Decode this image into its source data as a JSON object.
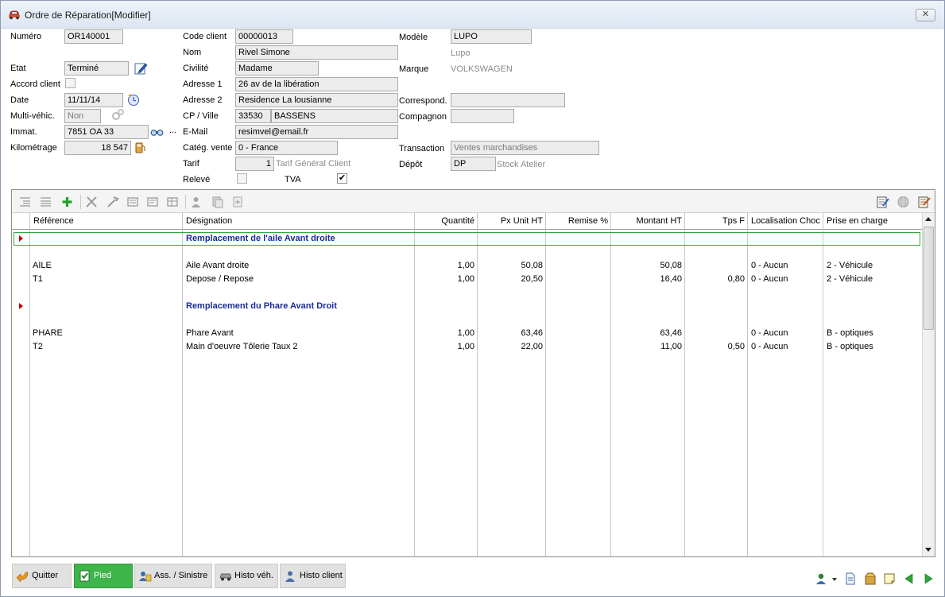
{
  "window": {
    "title": "Ordre de Réparation[Modifier]",
    "close_label": "✕"
  },
  "form": {
    "numero": {
      "label": "Numéro",
      "value": "OR140001"
    },
    "etat": {
      "label": "Etat",
      "value": "Terminé"
    },
    "accord": {
      "label": "Accord client"
    },
    "date": {
      "label": "Date",
      "value": "11/11/14"
    },
    "multi": {
      "label": "Multi-véhic.",
      "value": "Non"
    },
    "immat": {
      "label": "Immat.",
      "value": "7851 OA 33",
      "more": "..."
    },
    "km": {
      "label": "Kilométrage",
      "value": "18 547"
    },
    "code_client": {
      "label": "Code client",
      "value": "00000013"
    },
    "nom": {
      "label": "Nom",
      "value": "Rivel Simone"
    },
    "civilite": {
      "label": "Civilité",
      "value": "Madame"
    },
    "adresse1": {
      "label": "Adresse 1",
      "value": "26 av de la libération"
    },
    "adresse2": {
      "label": "Adresse 2",
      "value": "Residence La lousianne"
    },
    "cp_ville": {
      "label": "CP / Ville",
      "cp": "33530",
      "ville": "BASSENS"
    },
    "email": {
      "label": "E-Mail",
      "value": "resimvel@email.fr"
    },
    "categ": {
      "label": "Catég. vente",
      "value": "0 - France"
    },
    "tarif": {
      "label": "Tarif",
      "value": "1",
      "desc": "Tarif Général Client"
    },
    "releve": {
      "label": "Relevé"
    },
    "tva": {
      "label": "TVA",
      "checked": "✔"
    },
    "modele": {
      "label": "Modèle",
      "value": "LUPO",
      "sub": "Lupo"
    },
    "marque": {
      "label": "Marque",
      "value": "VOLKSWAGEN"
    },
    "correspond": {
      "label": "Correspond.",
      "value": ""
    },
    "compagnon": {
      "label": "Compagnon",
      "value": ""
    },
    "transaction": {
      "label": "Transaction",
      "value": "Ventes marchandises"
    },
    "depot": {
      "label": "Dépôt",
      "value": "DP",
      "desc": "Stock Atelier"
    }
  },
  "grid": {
    "columns": [
      "Référence",
      "Désignation",
      "Quantité",
      "Px Unit HT",
      "Remise %",
      "Montant HT",
      "Tps F",
      "Localisation Choc",
      "Prise en charge"
    ],
    "sections": [
      {
        "title": "Remplacement de l'aile Avant droite",
        "rows": [
          {
            "ref": "AILE",
            "des": "Aile Avant droite",
            "qte": "1,00",
            "px": "50,08",
            "remise": "",
            "montant": "50,08",
            "tps": "",
            "loc": "0 - Aucun",
            "prise": "2 - Véhicule"
          },
          {
            "ref": "T1",
            "des": "Depose / Repose",
            "qte": "1,00",
            "px": "20,50",
            "remise": "",
            "montant": "16,40",
            "tps": "0,80",
            "loc": "0 - Aucun",
            "prise": "2 - Véhicule"
          }
        ]
      },
      {
        "title": "Remplacement du Phare Avant Droit",
        "rows": [
          {
            "ref": "PHARE",
            "des": "Phare Avant",
            "qte": "1,00",
            "px": "63,46",
            "remise": "",
            "montant": "63,46",
            "tps": "",
            "loc": "0 - Aucun",
            "prise": "B - optiques"
          },
          {
            "ref": "T2",
            "des": "Main d'oeuvre Tôlerie Taux 2",
            "qte": "1,00",
            "px": "22,00",
            "remise": "",
            "montant": "11,00",
            "tps": "0,50",
            "loc": "0 - Aucun",
            "prise": "B - optiques"
          }
        ]
      }
    ]
  },
  "footer": {
    "quitter": "Quitter",
    "pied": "Pied",
    "ass": "Ass. / Sinistre",
    "histo_veh": "Histo véh.",
    "histo_client": "Histo client"
  },
  "colors": {
    "accent_green": "#3fb44a",
    "section_title": "#1b2a9a",
    "row_marker": "#c40000"
  }
}
